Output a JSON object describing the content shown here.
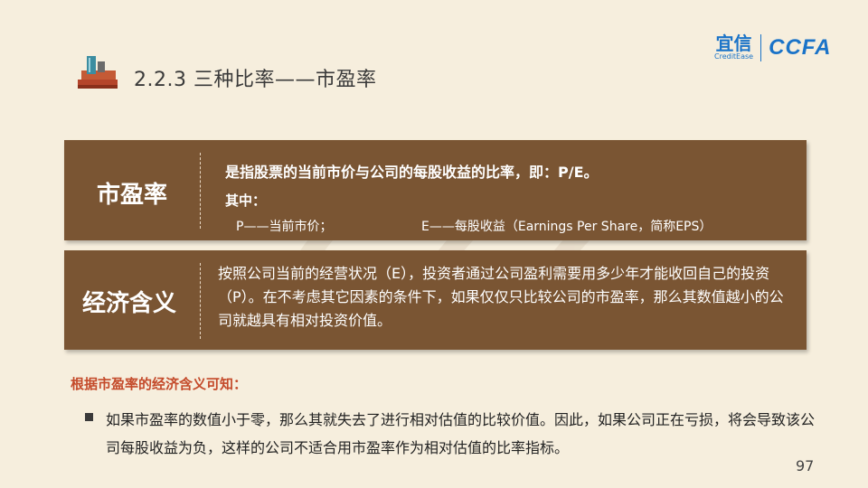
{
  "header": {
    "section_title": "2.2.3 三种比率——市盈率"
  },
  "logo": {
    "yixin_cn": "宜信",
    "yixin_en": "CreditEase",
    "ccfa": "CCFA"
  },
  "definition_box": {
    "label": "市盈率",
    "definition": "是指股票的当前市价与公司的每股收益的比率，即：P/E。",
    "qizhong": "其中：",
    "p_def": "P——当前市价；",
    "e_def": "E——每股收益（Earnings Per Share，简称EPS）"
  },
  "meaning_box": {
    "label": "经济含义",
    "text": "按照公司当前的经营状况（E），投资者通过公司盈利需要用多少年才能收回自己的投资（P）。在不考虑其它因素的条件下，如果仅仅只比较公司的市盈率，那么其数值越小的公司就越具有相对投资价值。"
  },
  "conclusion": {
    "title": "根据市盈率的经济含义可知：",
    "bullet": "如果市盈率的数值小于零，那么其就失去了进行相对估值的比较价值。因此，如果公司正在亏损，将会导致该公司每股收益为负，这样的公司不适合用市盈率作为相对估值的比率指标。"
  },
  "page_number": "97",
  "colors": {
    "background": "#f6eedd",
    "box_brown": "#7a5533",
    "accent_red": "#c44a2a",
    "logo_blue": "#1a73c8"
  }
}
